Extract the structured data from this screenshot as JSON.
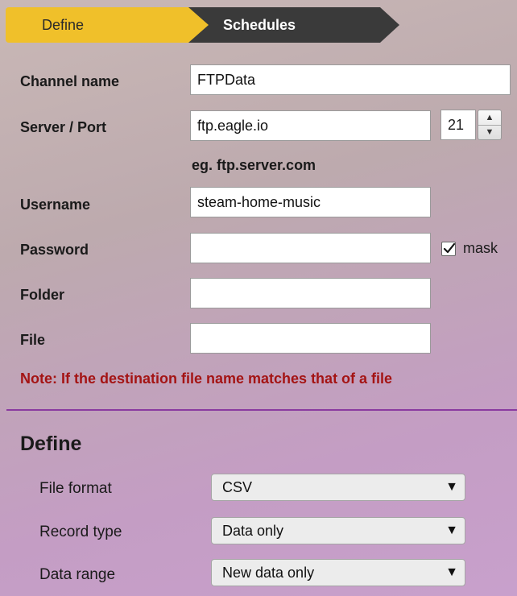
{
  "tabs": {
    "define": "Define",
    "schedules": "Schedules"
  },
  "form": {
    "channel_name": {
      "label": "Channel name",
      "value": "FTPData"
    },
    "server_port": {
      "label": "Server / Port",
      "server": "ftp.eagle.io",
      "port": "21"
    },
    "hint": "eg. ftp.server.com",
    "username": {
      "label": "Username",
      "value": "steam-home-music"
    },
    "password": {
      "label": "Password",
      "value": ""
    },
    "mask": {
      "label": "mask",
      "checked": true
    },
    "folder": {
      "label": "Folder",
      "value": ""
    },
    "file": {
      "label": "File",
      "value": ""
    },
    "note": "Note: If the destination file name matches that of a file"
  },
  "define_section": {
    "title": "Define",
    "file_format": {
      "label": "File format",
      "selected": "CSV"
    },
    "record_type": {
      "label": "Record type",
      "selected": "Data only"
    },
    "data_range": {
      "label": "Data range",
      "selected": "New data only"
    }
  },
  "icons": {
    "dropdown": "triangle-down",
    "stepper_up": "triangle-up",
    "stepper_down": "triangle-down",
    "checkbox": "check-mark"
  }
}
